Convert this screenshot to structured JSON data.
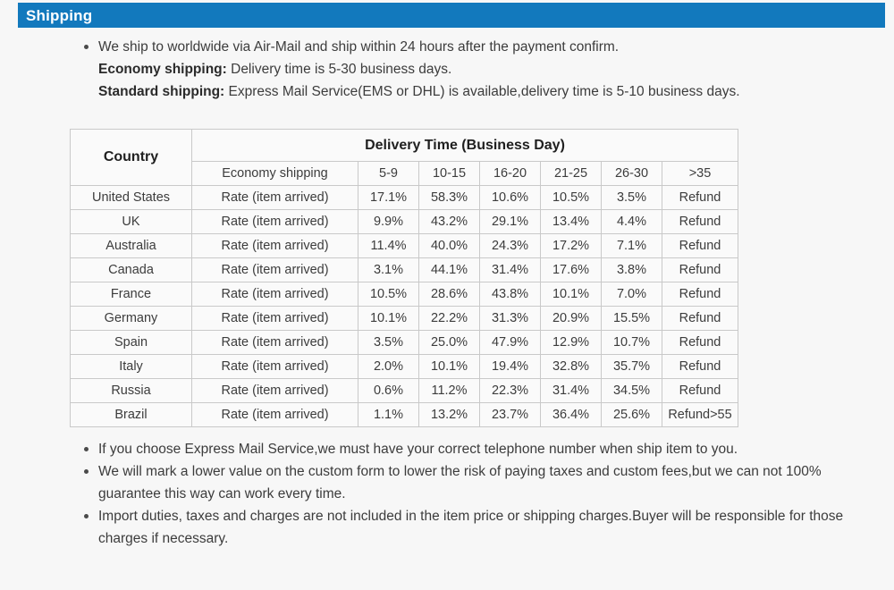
{
  "header": {
    "title": "Shipping",
    "accent_color": "#1279bd",
    "text_color": "#ffffff"
  },
  "page": {
    "background_color": "#f7f7f7",
    "text_color": "#3c3c3c"
  },
  "intro_bullets": [
    {
      "lines": [
        {
          "text": "We ship to worldwide via Air-Mail and ship within 24 hours after the payment confirm."
        },
        {
          "bold": "Economy shipping:",
          "text": " Delivery time is 5-30 business days."
        },
        {
          "bold": "Standard shipping:",
          "text": " Express Mail Service(EMS or DHL) is available,delivery time is 5-10 business days."
        }
      ]
    }
  ],
  "table": {
    "country_header": "Country",
    "group_header": "Delivery Time (Business Day)",
    "sub_headers": [
      "Economy shipping",
      "5-9",
      "10-15",
      "16-20",
      "21-25",
      "26-30",
      ">35"
    ],
    "rows": [
      {
        "country": "United States",
        "economy": "Rate (item arrived)",
        "values": [
          "17.1%",
          "58.3%",
          "10.6%",
          "10.5%",
          "3.5%",
          "Refund"
        ]
      },
      {
        "country": "UK",
        "economy": "Rate (item arrived)",
        "values": [
          "9.9%",
          "43.2%",
          "29.1%",
          "13.4%",
          "4.4%",
          "Refund"
        ]
      },
      {
        "country": "Australia",
        "economy": "Rate (item arrived)",
        "values": [
          "11.4%",
          "40.0%",
          "24.3%",
          "17.2%",
          "7.1%",
          "Refund"
        ]
      },
      {
        "country": "Canada",
        "economy": "Rate (item arrived)",
        "values": [
          "3.1%",
          "44.1%",
          "31.4%",
          "17.6%",
          "3.8%",
          "Refund"
        ]
      },
      {
        "country": "France",
        "economy": "Rate (item arrived)",
        "values": [
          "10.5%",
          "28.6%",
          "43.8%",
          "10.1%",
          "7.0%",
          "Refund"
        ]
      },
      {
        "country": "Germany",
        "economy": "Rate (item arrived)",
        "values": [
          "10.1%",
          "22.2%",
          "31.3%",
          "20.9%",
          "15.5%",
          "Refund"
        ]
      },
      {
        "country": "Spain",
        "economy": "Rate (item arrived)",
        "values": [
          "3.5%",
          "25.0%",
          "47.9%",
          "12.9%",
          "10.7%",
          "Refund"
        ]
      },
      {
        "country": "Italy",
        "economy": "Rate (item arrived)",
        "values": [
          "2.0%",
          "10.1%",
          "19.4%",
          "32.8%",
          "35.7%",
          "Refund"
        ]
      },
      {
        "country": "Russia",
        "economy": "Rate (item arrived)",
        "values": [
          "0.6%",
          "11.2%",
          "22.3%",
          "31.4%",
          "34.5%",
          "Refund"
        ]
      },
      {
        "country": "Brazil",
        "economy": "Rate (item arrived)",
        "values": [
          "1.1%",
          "13.2%",
          "23.7%",
          "36.4%",
          "25.6%",
          "Refund>55"
        ]
      }
    ]
  },
  "outro_bullets": [
    {
      "text": "If you choose Express Mail Service,we must have your correct telephone number when ship item to you."
    },
    {
      "text": "We will mark a lower value on the custom form to lower the risk of paying taxes and custom fees,but we can not 100% guarantee this way can work every time."
    },
    {
      "text": "Import duties, taxes and charges are not included in the item price or shipping charges.Buyer will be responsible for those charges if necessary."
    }
  ]
}
